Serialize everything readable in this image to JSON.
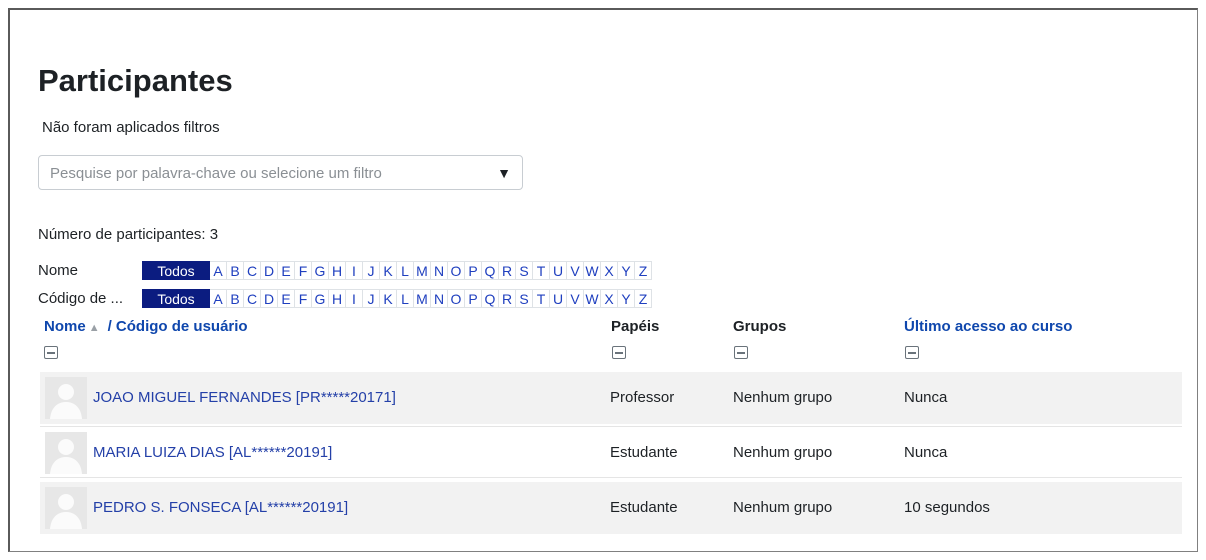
{
  "title": "Participantes",
  "filter_status": "Não foram aplicados filtros",
  "search": {
    "placeholder": "Pesquise por palavra-chave ou selecione um filtro",
    "arrow": "▼"
  },
  "participant_count": "Número de participantes: 3",
  "initials_rows": [
    {
      "label": "Nome",
      "all": "Todos",
      "selected": "Todos"
    },
    {
      "label": "Código de ...",
      "all": "Todos",
      "selected": "Todos"
    }
  ],
  "letters": [
    "A",
    "B",
    "C",
    "D",
    "E",
    "F",
    "G",
    "H",
    "I",
    "J",
    "K",
    "L",
    "M",
    "N",
    "O",
    "P",
    "Q",
    "R",
    "S",
    "T",
    "U",
    "V",
    "W",
    "X",
    "Y",
    "Z"
  ],
  "columns": {
    "name": "Nome",
    "user_code": "/ Código de usuário",
    "roles": "Papéis",
    "groups": "Grupos",
    "last_access": "Último acesso ao curso"
  },
  "participants": [
    {
      "name": "JOAO MIGUEL FERNANDES [PR*****20171]",
      "role": "Professor",
      "group": "Nenhum grupo",
      "last_access": "Nunca"
    },
    {
      "name": "MARIA LUIZA DIAS [AL******20191]",
      "role": "Estudante",
      "group": "Nenhum grupo",
      "last_access": "Nunca"
    },
    {
      "name": "PEDRO S. FONSECA [AL******20191]",
      "role": "Estudante",
      "group": "Nenhum grupo",
      "last_access": "10 segundos"
    }
  ],
  "colors": {
    "active_letter_bg": "#0b1c80",
    "link": "#2440a8",
    "row_stripe": "#f2f2f2"
  },
  "icons": {
    "sort": "sort-ascending-icon",
    "collapse": "collapse-column-icon",
    "avatar": "default-user-avatar-icon"
  }
}
